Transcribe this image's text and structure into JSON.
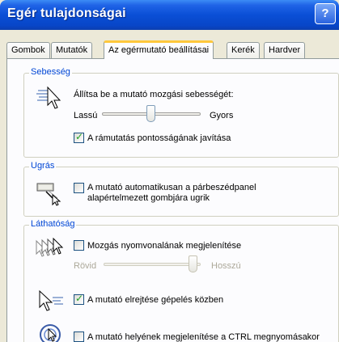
{
  "window": {
    "title": "Egér tulajdonságai",
    "help_label": "?"
  },
  "tabs": [
    {
      "label": "Gombok"
    },
    {
      "label": "Mutatók"
    },
    {
      "label": "Az egérmutató beállításai"
    },
    {
      "label": "Kerék"
    },
    {
      "label": "Hardver"
    }
  ],
  "speed": {
    "group_label": "Sebesség",
    "instruction": "Állítsa be a mutató mozgási sebességét:",
    "slow_label": "Lassú",
    "fast_label": "Gyors",
    "precision_label": "A rámutatás pontosságának javítása",
    "precision_checked": true
  },
  "snap": {
    "group_label": "Ugrás",
    "line1": "A mutató automatikusan a párbeszédpanel",
    "line2": "alapértelmezett gombjára ugrik",
    "checked": false
  },
  "visibility": {
    "group_label": "Láthatóság",
    "trails_label": "Mozgás nyomvonalának megjelenítése",
    "trails_checked": false,
    "short_label": "Rövid",
    "long_label": "Hosszú",
    "hide_label": "A mutató elrejtése gépelés közben",
    "hide_checked": true,
    "ctrl_label": "A mutató helyének megjelenítése a CTRL megnyomásakor",
    "ctrl_checked": false
  },
  "icons": {
    "help": "help-icon",
    "speed": "pointer-speed-icon",
    "snap": "snap-to-icon",
    "trails": "pointer-trails-icon",
    "hide": "hide-pointer-icon",
    "ctrl": "ctrl-locate-icon"
  },
  "colors": {
    "titlebar": "#0a4fd6",
    "group_label": "#0046d5",
    "check_mark": "#21a121",
    "active_tab_accent": "#ffc83c"
  }
}
